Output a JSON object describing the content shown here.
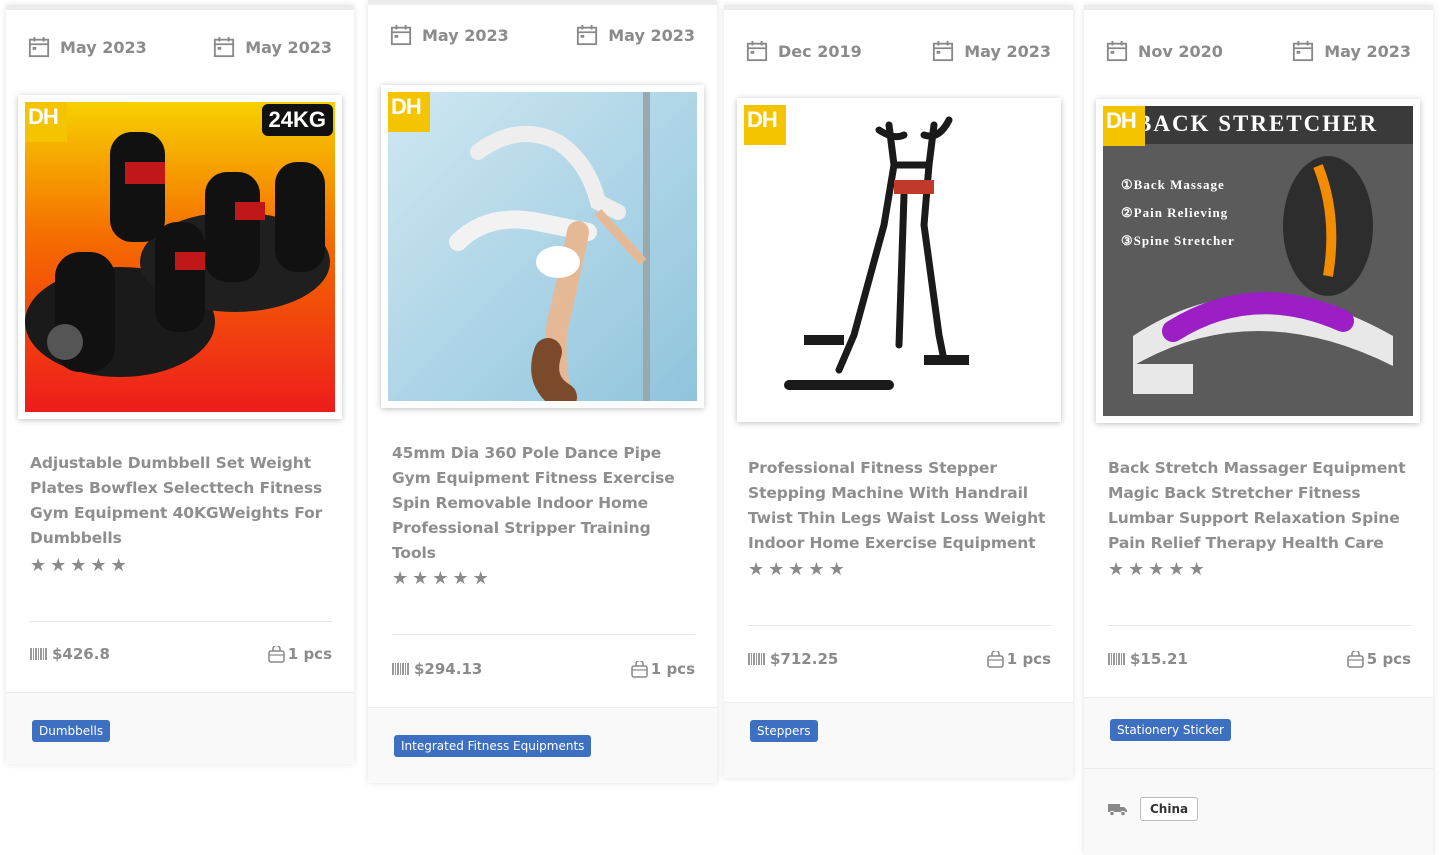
{
  "cards": [
    {
      "date_left": "May 2023",
      "date_right": "May 2023",
      "badge": "DH",
      "weight_badge": "24KG",
      "title": "Adjustable Dumbbell Set Weight Plates Bowflex Selecttech Fitness Gym Equipment 40KGWeights For Dumbbells",
      "rating_stars": 5,
      "price": "$426.8",
      "qty": "1 pcs",
      "tag": "Dumbbells"
    },
    {
      "date_left": "May 2023",
      "date_right": "May 2023",
      "badge": "DH",
      "title": "45mm Dia 360 Pole Dance Pipe Gym Equipment Fitness Exercise Spin Removable Indoor Home Professional Stripper Training Tools",
      "rating_stars": 5,
      "price": "$294.13",
      "qty": "1 pcs",
      "tag": "Integrated Fitness Equipments"
    },
    {
      "date_left": "Dec 2019",
      "date_right": "May 2023",
      "badge": "DH",
      "title": "Professional Fitness Stepper Stepping Machine With Handrail Twist Thin Legs Waist Loss Weight Indoor Home Exercise Equipment",
      "rating_stars": 5,
      "price": "$712.25",
      "qty": "1 pcs",
      "tag": "Steppers"
    },
    {
      "date_left": "Nov 2020",
      "date_right": "May 2023",
      "badge": "DH",
      "image_heading": "BACK STRETCHER",
      "image_points": [
        "①Back Massage",
        "②Pain Relieving",
        "③Spine Stretcher"
      ],
      "title": "Back Stretch Massager Equipment Magic Back Stretcher Fitness Lumbar Support Relaxation Spine Pain Relief Therapy Health Care",
      "rating_stars": 5,
      "price": "$15.21",
      "qty": "5 pcs",
      "tag": "Stationery Sticker",
      "origin": "China"
    }
  ],
  "icons": {
    "date": "calendar-icon",
    "price": "barcode-icon",
    "qty": "bag-icon",
    "shipping": "truck-icon",
    "rating": "star-icon"
  },
  "colors": {
    "tag_bg": "#3e70c2",
    "badge_bg": "#f5c400",
    "text_muted": "#8b8b8b"
  }
}
